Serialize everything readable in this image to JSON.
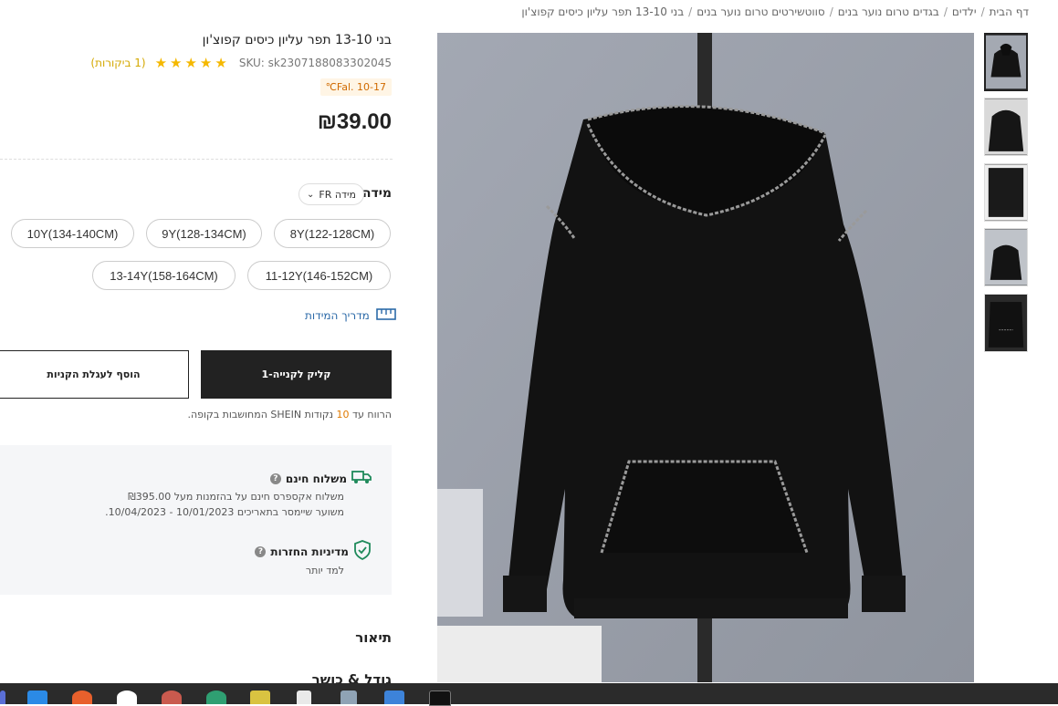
{
  "breadcrumb": {
    "items": [
      "דף הבית",
      "ילדים",
      "בגדים טרום נוער בנים",
      "סווטשירטים טרום נוער בנים",
      "בני 13-10 תפר עליון כיסים קפוצ'ון"
    ],
    "separator": "/"
  },
  "product": {
    "title": "בני 13-10 תפר עליון כיסים קפוצ'ון",
    "sku": "SKU: sk2307188083302045",
    "rating_stars": "★★★★★",
    "reviews": "(1 ביקורות)",
    "promo_badge": "℃Fal. 10-17",
    "price": "₪39.00"
  },
  "size": {
    "heading": "מידה",
    "region_value": "FR מידה",
    "options": [
      "8Y(122-128CM)",
      "9Y(128-134CM)",
      "10Y(134-140CM)",
      "11-12Y(146-152CM)",
      "13-14Y(158-164CM)"
    ],
    "guide_label": "מדריך המידות"
  },
  "actions": {
    "one_click": "1-קליק לקנייה",
    "add_to_cart": "הוסף לעגלת הקניות"
  },
  "points_note": {
    "prefix": "הרווח עד",
    "points": "10",
    "suffix": "נקודות SHEIN המחושבות בקופה."
  },
  "shipping": {
    "title": "משלוח חינם",
    "line1": "משלוח אקספרס חינם על בהזמנות מעל ₪395.00",
    "line2": "משוער שיימסר בתאריכים 10/01/2023 - 10/04/2023."
  },
  "returns": {
    "title": "מדיניות החזרות",
    "link": "למד יותר"
  },
  "sections": {
    "description": "תיאור",
    "size_fit": "גודל & כושר"
  },
  "colors": {
    "price": "#222222",
    "stars": "#f5b800",
    "points": "#e07a00",
    "link": "#2c6aa8",
    "shipping_icon": "#1f8a5b",
    "returns_icon": "#1f8a5b",
    "taskbar": "#2b2b2b"
  },
  "icons": {
    "shipping": "truck-icon",
    "returns": "shield-check-icon",
    "size_guide": "ruler-icon",
    "help": "question-circle-icon"
  }
}
